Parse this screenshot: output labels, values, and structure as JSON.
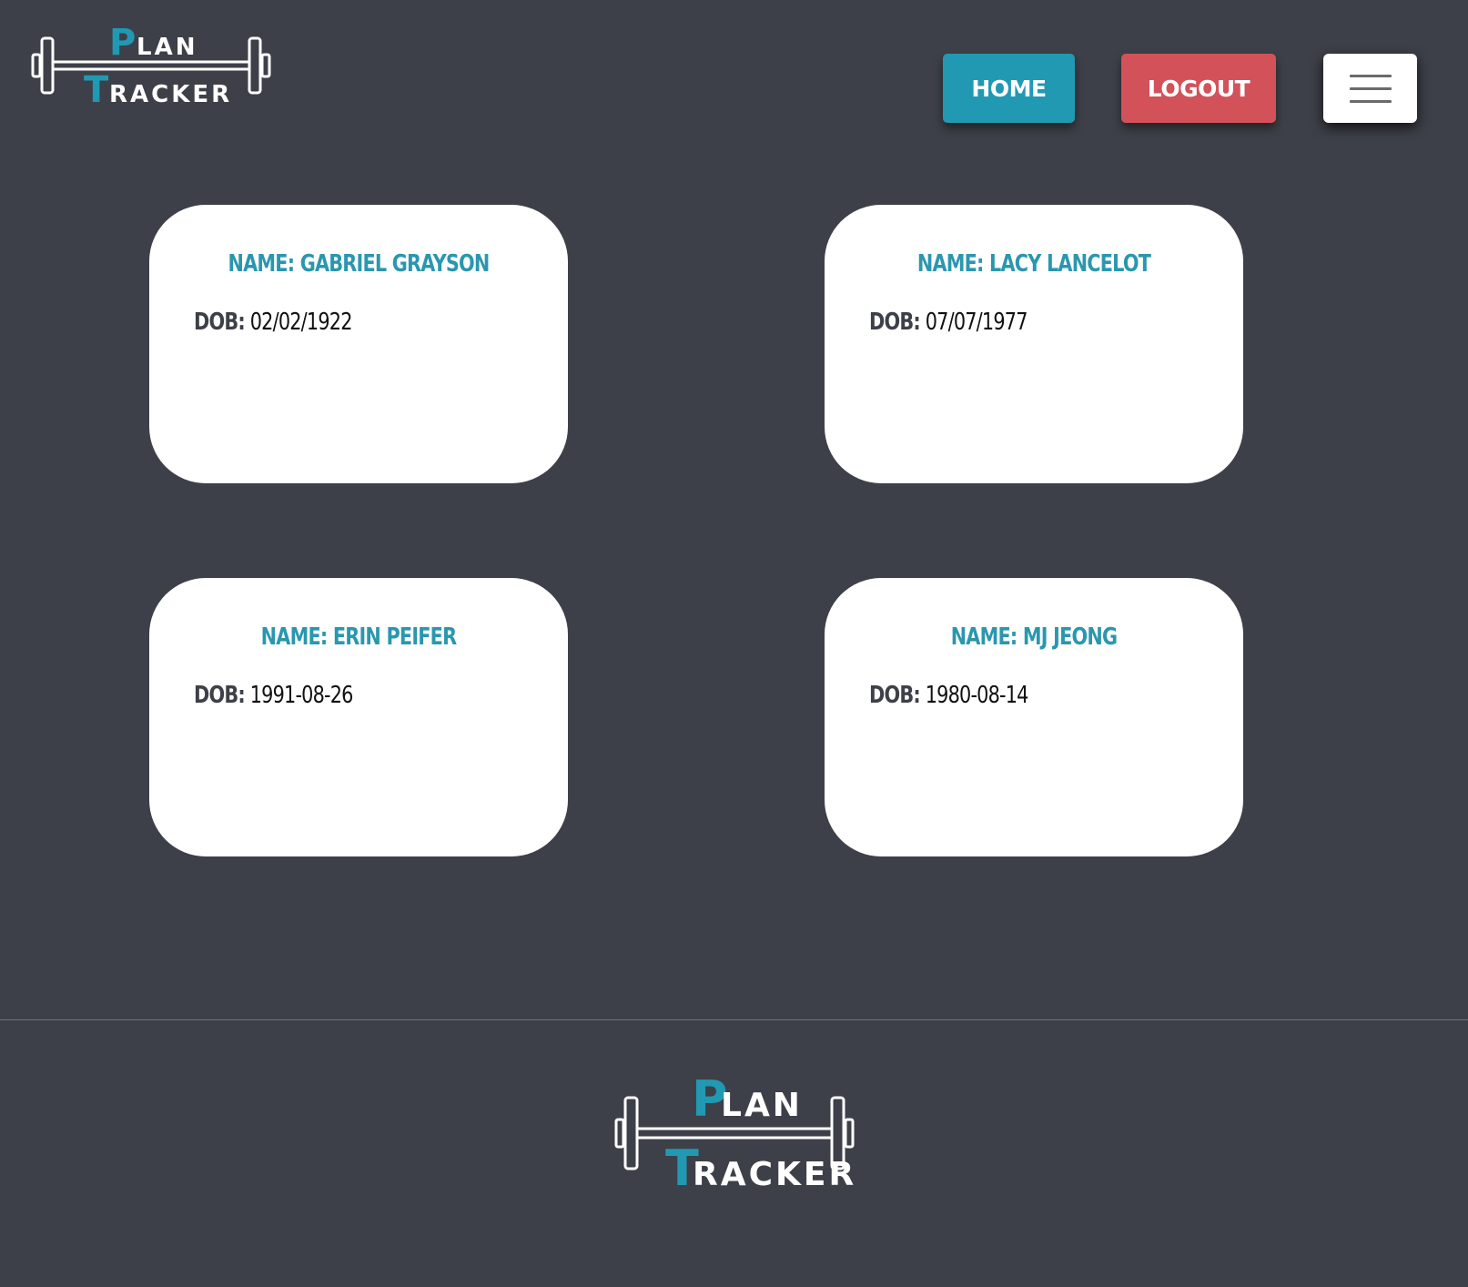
{
  "header": {
    "logo": {
      "line1_initial": "P",
      "line1_rest": "LAN",
      "line2_initial": "T",
      "line2_rest": "RACKER"
    },
    "home_label": "HOME",
    "logout_label": "LOGOUT",
    "menu_icon": "hamburger-menu-icon"
  },
  "cards": [
    {
      "name_label": "NAME:",
      "name": "GABRIEL GRAYSON",
      "dob_label": "DOB:",
      "dob": "02/02/1922"
    },
    {
      "name_label": "NAME:",
      "name": "LACY LANCELOT",
      "dob_label": "DOB:",
      "dob": "07/07/1977"
    },
    {
      "name_label": "NAME:",
      "name": "ERIN PEIFER",
      "dob_label": "DOB:",
      "dob": "1991-08-26"
    },
    {
      "name_label": "NAME:",
      "name": "MJ JEONG",
      "dob_label": "DOB:",
      "dob": "1980-08-14"
    }
  ],
  "footer": {
    "logo": {
      "line1_initial": "P",
      "line1_rest": "LAN",
      "line2_initial": "T",
      "line2_rest": "RACKER"
    }
  },
  "colors": {
    "background": "#3d4048",
    "accent": "#2199b2",
    "logout": "#d35259",
    "card": "#ffffff",
    "name_text": "#2a97af"
  }
}
